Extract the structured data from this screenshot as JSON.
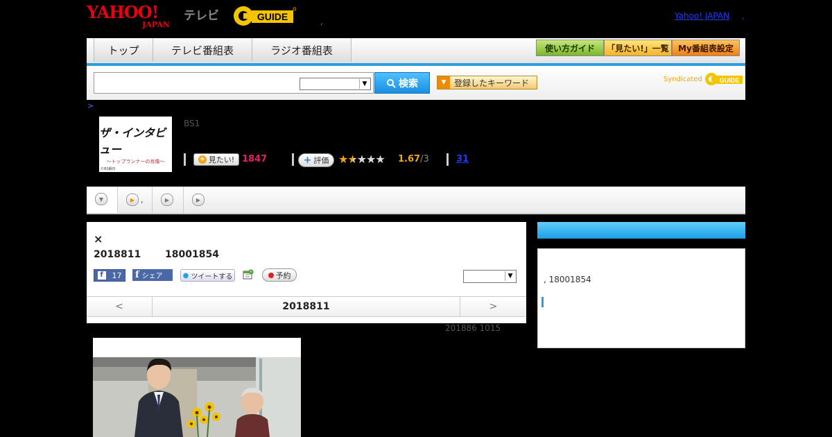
{
  "header": {
    "yahoo_logo": "YAHOO!",
    "yahoo_sub": "JAPAN",
    "tv_label": "テレビ",
    "gguide_logo": "G-GUIDE",
    "dot": ",",
    "yahoo_japan_link": "Yahoo! JAPAN",
    "link_dot": ","
  },
  "nav": {
    "tabs": [
      "トップ",
      "テレビ番組表",
      "ラジオ番組表"
    ],
    "util_buttons": [
      "使い方ガイド",
      "「見たい!」一覧",
      "My番組表設定"
    ]
  },
  "search": {
    "value": "",
    "button_label": "検索",
    "keyword_button": "登録したキーワード",
    "syndicated_label": "Syndicated"
  },
  "breadcrumb": ">",
  "program": {
    "logo_title": "ザ・インタビュー",
    "logo_sub": "〜トップランナーの肖像〜",
    "logo_copy": "©BS朝日",
    "channel": "BS1",
    "mitai_label": "見たい!",
    "mitai_count": "1847",
    "hyoka_label": "評価",
    "rating": 1.67,
    "rating_text": "1.67",
    "rating_max": "/3",
    "comments": "31"
  },
  "main": {
    "title": "×",
    "date": "2018811",
    "time": "18001854",
    "fb_like_count": "17",
    "fb_share": "シェア",
    "tweet": "ツイートする",
    "reserve": "予約",
    "prev": "<",
    "current_date": "2018811",
    "next": ">",
    "updated": "201886  1015"
  },
  "side": {
    "text": ", 18001854"
  },
  "colors": {
    "accent_blue": "#2a9fe0",
    "mitai_pink": "#e6206b",
    "star_orange": "#f3a51a"
  }
}
